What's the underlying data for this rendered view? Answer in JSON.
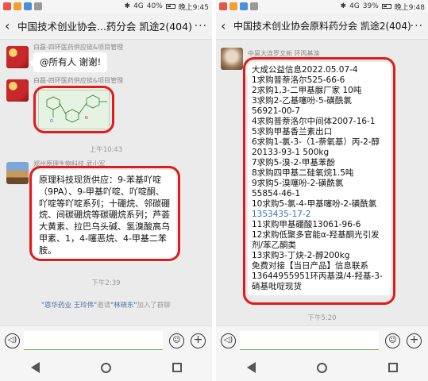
{
  "left": {
    "status": {
      "signal": "4G",
      "battery": "40%",
      "time": "晚上9:45"
    },
    "title": "中国技术创业协会...药分会 凯途2(404)",
    "messages": [
      {
        "sender": "白磊-四环医药供应链&项目管理",
        "text": "@所有人  谢谢!"
      },
      {
        "sender": "白磊-四环医药供应链&项目管理",
        "image": "chemical-structure"
      },
      {
        "time": "上午10:43"
      },
      {
        "sender": "郑州原理生物科技 武小军",
        "text": "原理科技现货供应：9-苯基吖啶（9PA）、9-甲基吖啶、吖啶酮、吖啶等吖啶系列；十硼烷、邻碳硼烷、间碳硼烷等碳硼烷系列；芦荟大黄素、拉巴乌头碱、氢溴酸高乌甲素、1，4-噻恶烷、4-甲基二苯胺。"
      },
      {
        "time": "下午2:39"
      },
      {
        "system": {
          "a": "\"恩华药业 王玲伟\"",
          "b": "邀请",
          "c": "\"林晓东\"",
          "d": "加入了群聊"
        }
      }
    ]
  },
  "right": {
    "status": {
      "signal": "4G",
      "battery": "39%",
      "time": "晚上9:48"
    },
    "title": "中国技术创业协会原料药分会 凯途2(404)",
    "messages": [
      {
        "sender": "中昊大连罗文新 环丙基溴",
        "lines": [
          "大成公益信息2022.05.07-4",
          "1求购普萘洛尔525-66-6",
          "2求购1,3-二甲基脲厂家 10吨",
          "3求购2-乙基噻吩-5-磺酰氯",
          "56921-00-7",
          "4求购普萘洛尔中间体2007-16-1",
          "5求购甲基香兰素出口",
          "6求购1-氯-3-（1-萘氧基）丙-2-醇",
          "20133-93-1  500kg",
          "7求购5-溴-2-甲基苯酚",
          "8求购四甲基二硅氧烷1.5吨",
          "9求购5-溴噻吩-2-磺酰氯",
          "55854-46-1",
          "10求购5-氯-4-甲基噻吩-2-磺酰氯",
          "1353435-17-2",
          "11求购甲基硼酸13061-96-6",
          "12求购低聚多官能α-羟基酮光引发剂/苯乙酮类",
          "13求购3-丁炔-2-醇200kg",
          "免费对接【当日产品】信息联系13644955951环丙基溴/4-羟基-3-硝基吡啶现货"
        ]
      },
      {
        "time": "下午5:20"
      }
    ]
  },
  "colors": {
    "ring": "#e01b1b",
    "chat_bg": "#ebebeb",
    "link": "#3a6fb8"
  }
}
